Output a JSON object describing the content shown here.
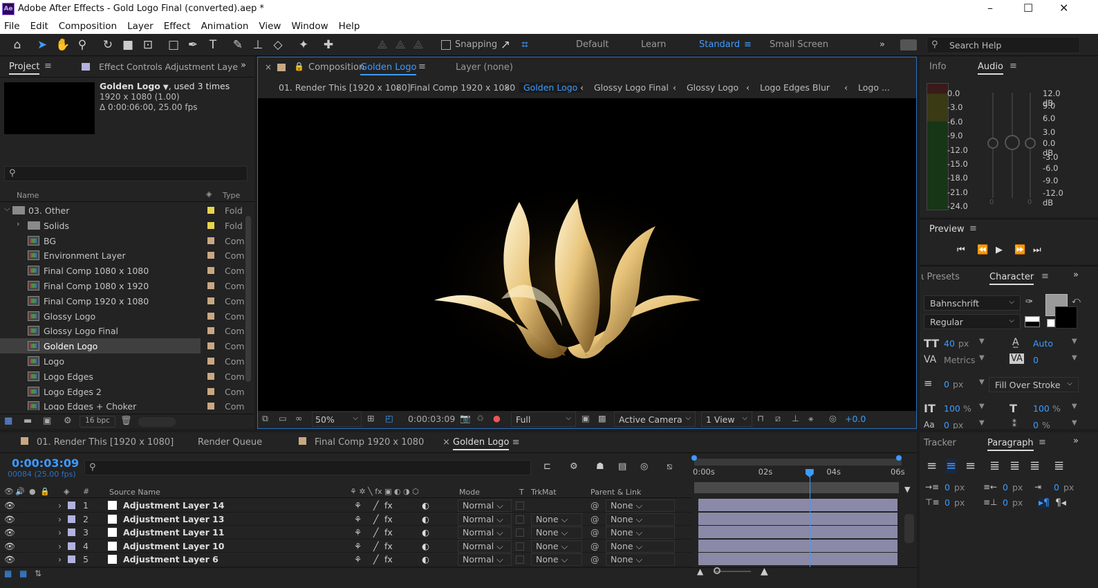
{
  "app": {
    "title": "Adobe After Effects - Gold Logo Final (converted).aep *",
    "logo_text": "Ae",
    "window_controls": [
      "–",
      "☐",
      "✕"
    ]
  },
  "menu": [
    "File",
    "Edit",
    "Composition",
    "Layer",
    "Effect",
    "Animation",
    "View",
    "Window",
    "Help"
  ],
  "toolbar": {
    "snapping_label": "Snapping",
    "workspaces": [
      "Default",
      "Learn",
      "Standard",
      "Small Screen"
    ],
    "active_workspace": "Standard",
    "search_placeholder": "Search Help"
  },
  "project_panel": {
    "tab_project": "Project",
    "tab_effect_controls": "Effect Controls Adjustment Laye",
    "comp_name": "Golden Logo",
    "used_times": ", used 3 times",
    "dimensions": "1920 x 1080 (1.00)",
    "duration": "Δ 0:00:06:00, 25.00 fps",
    "search_placeholder": "",
    "col_name": "Name",
    "col_type": "Type",
    "bpc": "16 bpc",
    "items": [
      {
        "name": "03. Other",
        "type": "Fold",
        "kind": "folder",
        "label_color": "#e8d44d",
        "indent": 0,
        "expanded": true
      },
      {
        "name": "Solids",
        "type": "Fold",
        "kind": "folder",
        "label_color": "#e8d44d",
        "indent": 1,
        "expanded": false
      },
      {
        "name": "BG",
        "type": "Com",
        "kind": "comp",
        "label_color": "#c8a883",
        "indent": 1
      },
      {
        "name": "Environment Layer",
        "type": "Com",
        "kind": "comp",
        "label_color": "#c8a883",
        "indent": 1
      },
      {
        "name": "Final Comp 1080 x 1080",
        "type": "Com",
        "kind": "comp",
        "label_color": "#c8a883",
        "indent": 1
      },
      {
        "name": "Final Comp 1080 x 1920",
        "type": "Com",
        "kind": "comp",
        "label_color": "#c8a883",
        "indent": 1
      },
      {
        "name": "Final Comp 1920 x 1080",
        "type": "Com",
        "kind": "comp",
        "label_color": "#c8a883",
        "indent": 1
      },
      {
        "name": "Glossy Logo",
        "type": "Com",
        "kind": "comp",
        "label_color": "#c8a883",
        "indent": 1
      },
      {
        "name": "Glossy Logo Final",
        "type": "Com",
        "kind": "comp",
        "label_color": "#c8a883",
        "indent": 1
      },
      {
        "name": "Golden Logo",
        "type": "Com",
        "kind": "comp",
        "label_color": "#c8a883",
        "indent": 1,
        "selected": true
      },
      {
        "name": "Logo",
        "type": "Com",
        "kind": "comp",
        "label_color": "#c8a883",
        "indent": 1
      },
      {
        "name": "Logo Edges",
        "type": "Com",
        "kind": "comp",
        "label_color": "#c8a883",
        "indent": 1
      },
      {
        "name": "Logo Edges 2",
        "type": "Com",
        "kind": "comp",
        "label_color": "#c8a883",
        "indent": 1
      },
      {
        "name": "Logo Edges + Choker",
        "type": "Com",
        "kind": "comp",
        "label_color": "#c8a883",
        "indent": 1
      }
    ]
  },
  "composition_panel": {
    "tab_prefix": "Composition",
    "tab_comp": "Golden Logo",
    "tab_layer": "Layer  (none)",
    "breadcrumbs": [
      "01. Render This [1920 x 1080]",
      "Final Comp 1920 x 1080",
      "Golden Logo",
      "Glossy Logo Final",
      "Glossy Logo",
      "Logo Edges Blur",
      "Logo ..."
    ],
    "active_breadcrumb": "Golden Logo",
    "zoom": "50%",
    "timecode": "0:00:03:09",
    "resolution": "Full",
    "camera": "Active Camera",
    "views": "1 View",
    "exposure": "+0.0"
  },
  "info_panel": {
    "tab_info": "Info",
    "tab_audio": "Audio",
    "left_scale": [
      "0.0",
      "-3.0",
      "-6.0",
      "-9.0",
      "-12.0",
      "-15.0",
      "-18.0",
      "-21.0",
      "-24.0"
    ],
    "right_scale": [
      "12.0 dB",
      "9.0",
      "6.0",
      "3.0",
      "0.0 dB",
      "-3.0",
      "-6.0",
      "-9.0",
      "-12.0 dB"
    ],
    "slider_zero_left": "0",
    "slider_zero_right": "0"
  },
  "preview_panel": {
    "title": "Preview"
  },
  "character_panel": {
    "tab_presets": "ι Presets",
    "tab_character": "Character",
    "font": "Bahnschrift",
    "style": "Regular",
    "size": "40",
    "size_unit": "px",
    "leading": "Auto",
    "kerning": "Metrics",
    "tracking": "0",
    "stroke_width": "0",
    "stroke_unit": "px",
    "stroke_mode": "Fill Over Stroke",
    "vscale": "100",
    "vscale_unit": "%",
    "hscale": "100",
    "hscale_unit": "%",
    "baseline": "0",
    "baseline_unit": "px",
    "tsume": "0",
    "tsume_unit": "%",
    "fill_color": "#9a9a9a"
  },
  "paragraph_panel": {
    "tab_tracker": "Tracker",
    "tab_paragraph": "Paragraph",
    "indent_values": [
      "0",
      "px",
      "0",
      "px",
      "0",
      "px",
      "0",
      "px",
      "0",
      "px"
    ]
  },
  "timeline": {
    "tabs": [
      {
        "label": "01. Render This [1920 x 1080]",
        "color": "#c8a883"
      },
      {
        "label": "Render Queue",
        "color": ""
      },
      {
        "label": "Final Comp 1920 x 1080",
        "color": "#c8a883"
      },
      {
        "label": "Golden Logo",
        "color": "",
        "active": true
      }
    ],
    "current_time": "0:00:03:09",
    "frame_info": "00084 (25.00 fps)",
    "col_source": "Source Name",
    "col_mode": "Mode",
    "col_t": "T",
    "col_trkmat": "TrkMat",
    "col_parent": "Parent & Link",
    "ruler": [
      "0:00s",
      "02s",
      "04s",
      "06s"
    ],
    "playhead_fraction": 0.5633,
    "layers": [
      {
        "num": "1",
        "name": "Adjustment Layer 14",
        "mode": "Normal",
        "trkmat": "",
        "parent": "None"
      },
      {
        "num": "2",
        "name": "Adjustment Layer 13",
        "mode": "Normal",
        "trkmat": "None",
        "parent": "None"
      },
      {
        "num": "3",
        "name": "Adjustment Layer 11",
        "mode": "Normal",
        "trkmat": "None",
        "parent": "None"
      },
      {
        "num": "4",
        "name": "Adjustment Layer 10",
        "mode": "Normal",
        "trkmat": "None",
        "parent": "None"
      },
      {
        "num": "5",
        "name": "Adjustment Layer 6",
        "mode": "Normal",
        "trkmat": "None",
        "parent": "None"
      }
    ]
  },
  "colors": {
    "accent": "#3d9bff",
    "gold": "#e8c47a",
    "layer_bar": "#8a8aa8"
  }
}
